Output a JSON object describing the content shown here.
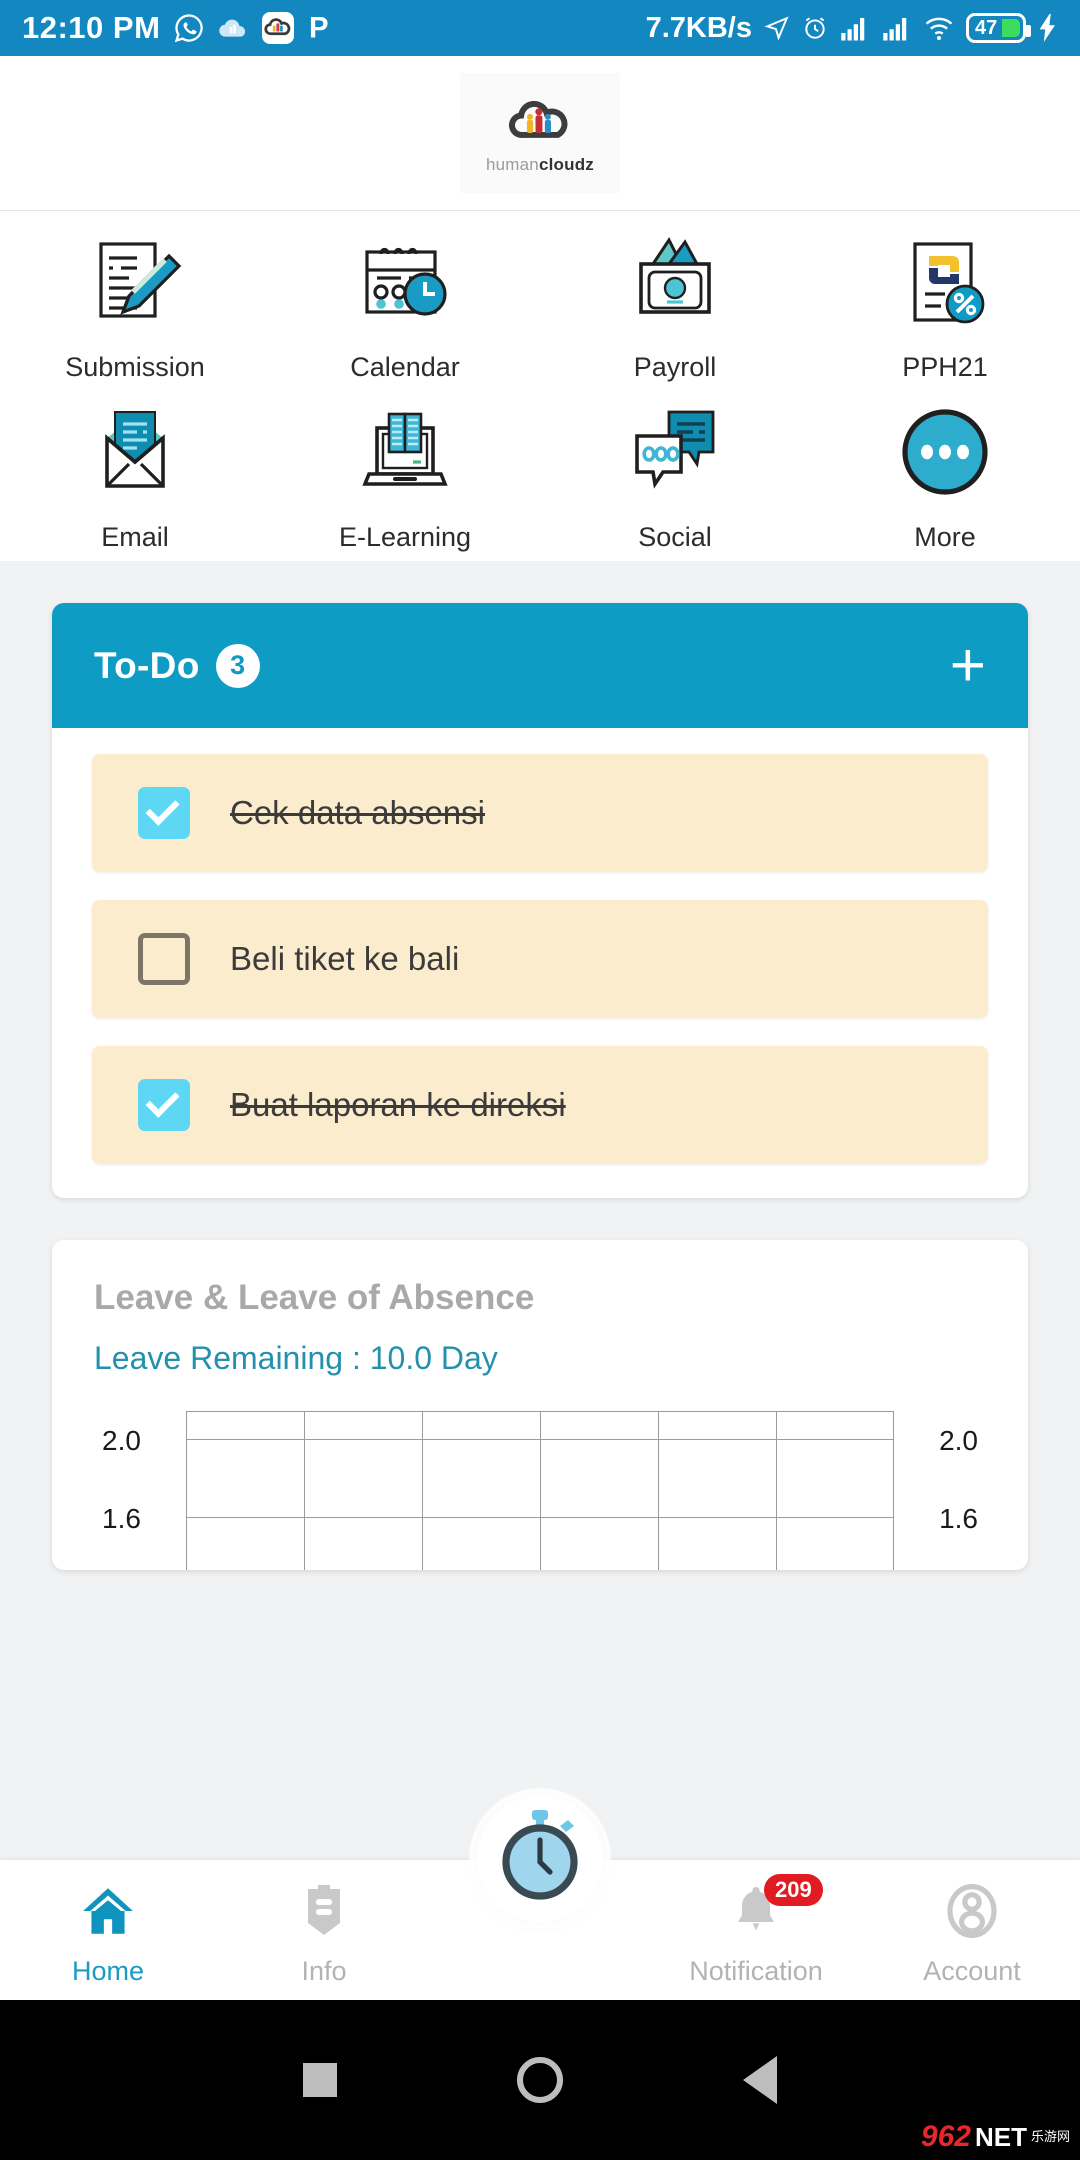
{
  "statusbar": {
    "time": "12:10 PM",
    "network_speed": "7.7KB/s",
    "battery_level": "47",
    "icons": [
      "whatsapp-icon",
      "cloud-icon",
      "humancloudz-app-icon",
      "p-app-icon",
      "location-arrow-icon",
      "alarm-icon",
      "signal-bars-icon",
      "signal-bars-2-icon",
      "wifi-icon",
      "battery-icon",
      "charging-bolt-icon"
    ]
  },
  "header": {
    "logo_text_light": "human",
    "logo_text_bold": "cloudz",
    "logo_icon": "cloud-people-logo"
  },
  "menu": {
    "items": [
      {
        "label": "Submission",
        "icon": "document-pencil-icon"
      },
      {
        "label": "Calendar",
        "icon": "calendar-clock-icon"
      },
      {
        "label": "Payroll",
        "icon": "cash-money-icon"
      },
      {
        "label": "PPH21",
        "icon": "tax-document-percent-icon"
      },
      {
        "label": "Email",
        "icon": "open-envelope-icon"
      },
      {
        "label": "E-Learning",
        "icon": "laptop-books-icon"
      },
      {
        "label": "Social",
        "icon": "chat-bubbles-icon"
      },
      {
        "label": "More",
        "icon": "more-dots-circle-icon"
      }
    ]
  },
  "todo": {
    "title": "To-Do",
    "count": "3",
    "add_label": "+",
    "items": [
      {
        "text": "Cek data absensi",
        "checked": true
      },
      {
        "text": "Beli tiket ke bali",
        "checked": false
      },
      {
        "text": "Buat laporan ke direksi",
        "checked": true
      }
    ]
  },
  "leave": {
    "title": "Leave & Leave of Absence",
    "remaining": "Leave Remaining : 10.0 Day"
  },
  "chart_data": {
    "type": "line",
    "title": "Leave & Leave of Absence",
    "x": [],
    "categories": [],
    "series": [
      {
        "name": "Leave",
        "values": []
      }
    ],
    "yticks_left": [
      "2.0",
      "1.6"
    ],
    "yticks_right": [
      "2.0",
      "1.6"
    ],
    "ylim": [
      1.2,
      2.4
    ],
    "grid": true,
    "xlabel": "",
    "ylabel": "",
    "legend": "none"
  },
  "bottomnav": {
    "items": [
      {
        "label": "Home",
        "icon": "home-icon",
        "active": true,
        "badge": ""
      },
      {
        "label": "Info",
        "icon": "info-mail-icon",
        "active": false,
        "badge": ""
      },
      {
        "label": "",
        "icon": "stopwatch-icon",
        "active": false,
        "badge": ""
      },
      {
        "label": "Notification",
        "icon": "bell-icon",
        "active": false,
        "badge": "209"
      },
      {
        "label": "Account",
        "icon": "account-user-icon",
        "active": false,
        "badge": ""
      }
    ]
  },
  "sysnav": {
    "buttons": [
      "square-recents-icon",
      "circle-home-icon",
      "triangle-back-icon"
    ]
  },
  "watermark": {
    "brand": "962",
    "net": "NET",
    "cn": "乐游网"
  },
  "colors": {
    "accent": "#1287c0",
    "todo_header": "#0e9bc4",
    "todo_item_bg": "#fbeccd",
    "checkbox_on": "#5ed7f5",
    "badge_red": "#e01b22",
    "teal": "#2391ad"
  }
}
